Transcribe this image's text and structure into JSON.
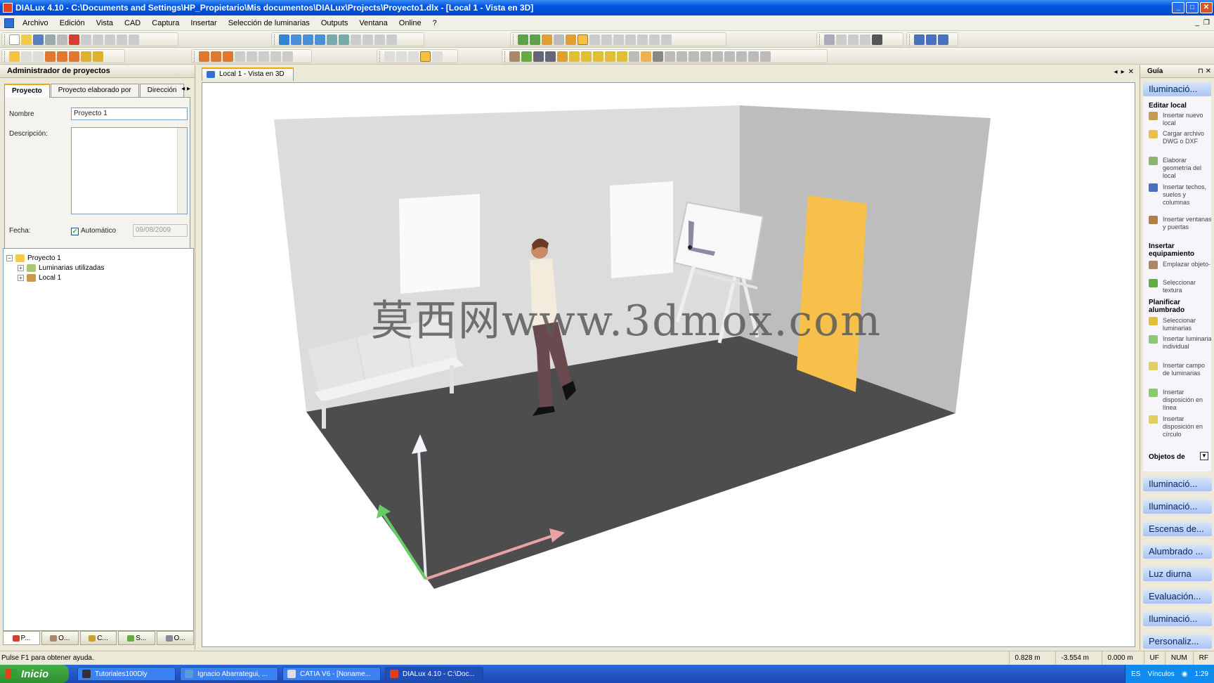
{
  "window": {
    "title": "DIALux 4.10 - C:\\Documents and Settings\\HP_Propietario\\Mis documentos\\DIALux\\Projects\\Proyecto1.dlx - [Local 1 - Vista en 3D]"
  },
  "menu": {
    "items": [
      "Archivo",
      "Edición",
      "Vista",
      "CAD",
      "Captura",
      "Insertar",
      "Selección de luminarias",
      "Outputs",
      "Ventana",
      "Online",
      "?"
    ]
  },
  "project_manager": {
    "title": "Administrador de proyectos",
    "tabs": [
      "Proyecto",
      "Proyecto elaborado por",
      "Dirección"
    ],
    "labels": {
      "name": "Nombre",
      "description": "Descripción:",
      "date": "Fecha:",
      "automatic": "Automático"
    },
    "name_value": "Proyecto 1",
    "description_value": "",
    "date_value": "09/08/2009",
    "automatic_checked": true,
    "tree": {
      "root": "Proyecto 1",
      "children": [
        "Luminarias utilizadas",
        "Local 1"
      ]
    },
    "bottom_tabs": [
      "P...",
      "O...",
      "C...",
      "S...",
      "O..."
    ]
  },
  "document": {
    "tab_label": "Local 1 - Vista en 3D",
    "watermark": "莫西网www.3dmox.com"
  },
  "guide": {
    "title": "Guía",
    "active_panel": "Iluminació...",
    "sections": [
      {
        "title": "Editar local",
        "items": [
          "Insertar nuevo local",
          "Cargar archivo DWG o DXF",
          "Elaborar geometría del local",
          "Insertar techos, suelos y columnas",
          "Insertar ventanas y puertas"
        ]
      },
      {
        "title": "Insertar equipamiento",
        "items": [
          "Emplazar objeto-",
          "Seleccionar textura"
        ]
      },
      {
        "title": "Planificar alumbrado",
        "items": [
          "Seleccionar luminarias",
          "Insertar luminaria individual",
          "Insertar campo de luminarias",
          "Insertar disposición en línea",
          "Insertar disposición en círculo"
        ]
      }
    ],
    "objects_label": "Objetos de",
    "panels": [
      "Iluminació...",
      "Iluminació...",
      "Escenas de...",
      "Alumbrado ...",
      "Luz diurna",
      "Evaluación...",
      "Iluminació...",
      "Personaliz..."
    ]
  },
  "statusbar": {
    "message": "Pulse F1 para obtener ayuda.",
    "x": "0.828 m",
    "y": "-3.554 m",
    "z": "0.000 m",
    "flags": [
      "UF",
      "NUM",
      "RF"
    ]
  },
  "taskbar": {
    "start": "Inicio",
    "tasks": [
      "Tutoriales100Dly",
      "Ignacio Abarrategui, ...",
      "CATIA V6 - [Noname...",
      "DIALux 4.10 - C:\\Doc..."
    ],
    "tray": {
      "lang": "ES",
      "links": "Vínculos",
      "time": "1:29"
    }
  },
  "colors": {
    "titlebar": "#0054e3",
    "door": "#f7c04a",
    "floor": "#4d4d4d",
    "accent_tab": "#f5a600"
  }
}
